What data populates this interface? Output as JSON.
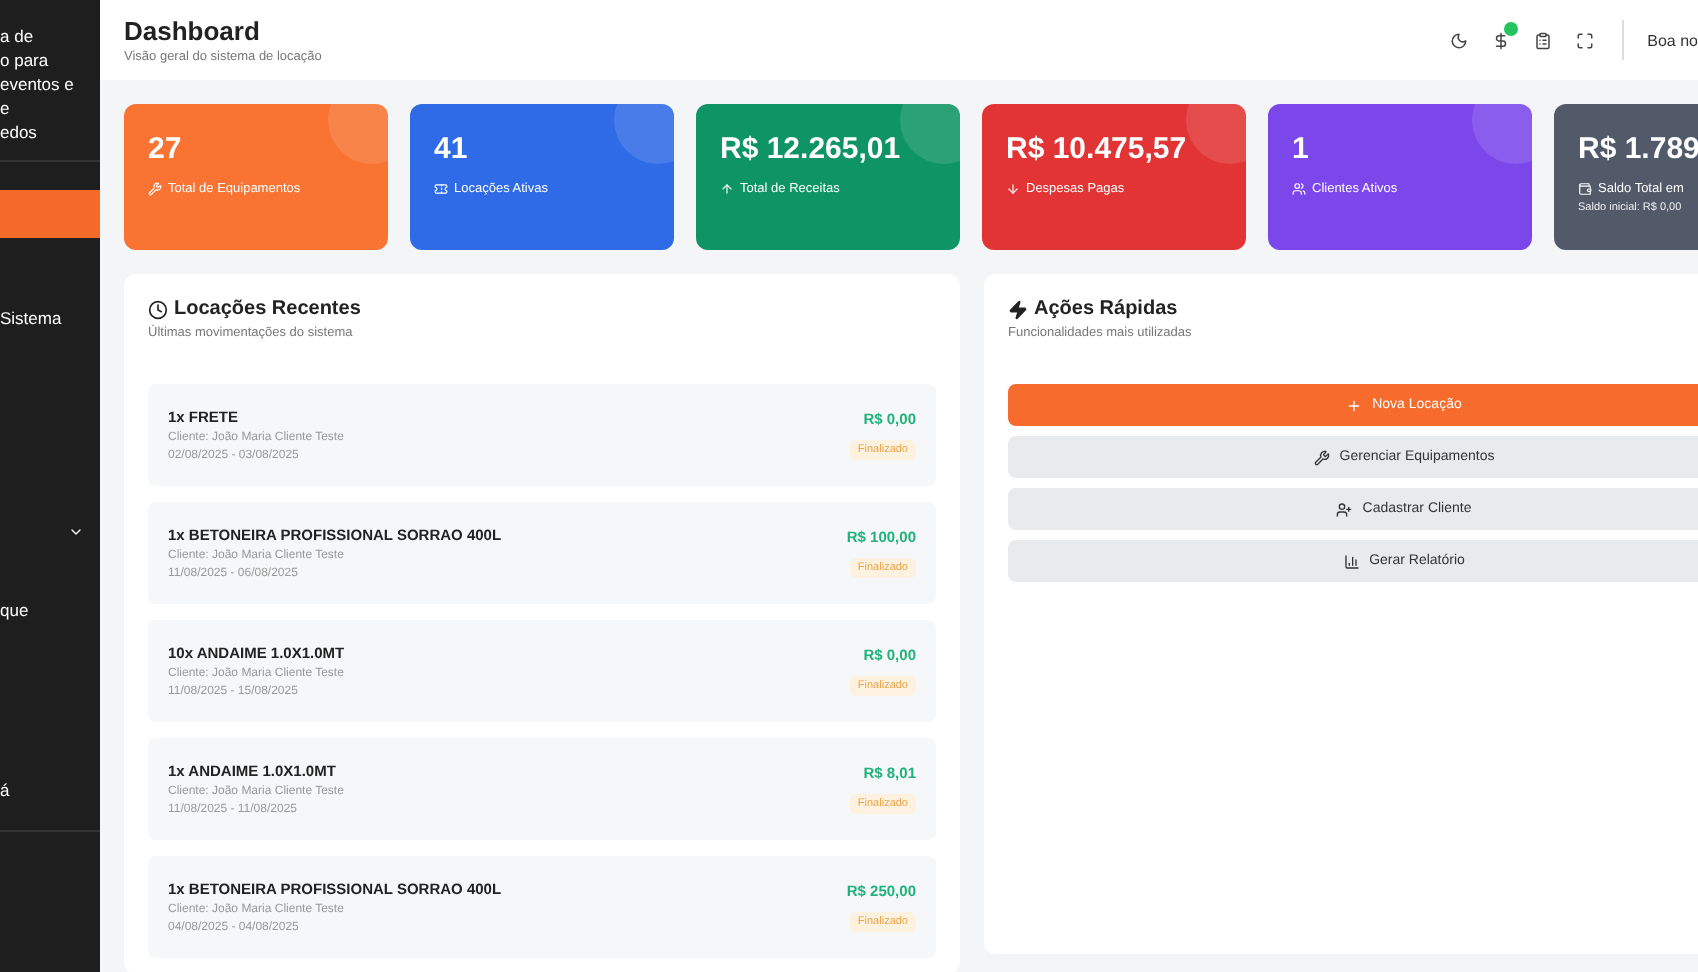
{
  "sidebar": {
    "brand_lines": [
      "a de",
      "o para",
      "eventos e",
      "e",
      "edos"
    ],
    "items": [
      {
        "selected": true
      },
      {
        "label": "Sistema",
        "selected": false
      },
      {
        "selected": false,
        "expanded": false
      },
      {
        "label": "que",
        "selected": false
      },
      {
        "label": "á",
        "selected": false
      }
    ]
  },
  "header": {
    "title": "Dashboard",
    "subtitle": "Visão geral do sistema de locação",
    "greeting": "Boa no"
  },
  "stats": [
    {
      "value": "27",
      "label": "Total de Equipamentos",
      "color": "#f97332"
    },
    {
      "value": "41",
      "label": "Locações Ativas",
      "color": "#2f6be6"
    },
    {
      "value": "R$ 12.265,01",
      "label": "Total de Receitas",
      "color": "#0e9465"
    },
    {
      "value": "R$ 10.475,57",
      "label": "Despesas Pagas",
      "color": "#e23434"
    },
    {
      "value": "1",
      "label": "Clientes Ativos",
      "color": "#7c47ea"
    },
    {
      "value": "R$ 1.789",
      "label": "Saldo Total em",
      "note": "Saldo inicial: R$ 0,00",
      "color": "#525a6a"
    }
  ],
  "recent": {
    "title": "Locações Recentes",
    "subtitle": "Últimas movimentações do sistema",
    "rows": [
      {
        "item": "1x FRETE",
        "client": "Cliente: João Maria Cliente Teste",
        "dates": "02/08/2025 - 03/08/2025",
        "amount": "R$ 0,00",
        "status": "Finalizado"
      },
      {
        "item": "1x BETONEIRA PROFISSIONAL SORRAO 400L",
        "client": "Cliente: João Maria Cliente Teste",
        "dates": "11/08/2025 - 06/08/2025",
        "amount": "R$ 100,00",
        "status": "Finalizado"
      },
      {
        "item": "10x ANDAIME 1.0X1.0MT",
        "client": "Cliente: João Maria Cliente Teste",
        "dates": "11/08/2025 - 15/08/2025",
        "amount": "R$ 0,00",
        "status": "Finalizado"
      },
      {
        "item": "1x ANDAIME 1.0X1.0MT",
        "client": "Cliente: João Maria Cliente Teste",
        "dates": "11/08/2025 - 11/08/2025",
        "amount": "R$ 8,01",
        "status": "Finalizado"
      },
      {
        "item": "1x BETONEIRA PROFISSIONAL SORRAO 400L",
        "client": "Cliente: João Maria Cliente Teste",
        "dates": "04/08/2025 - 04/08/2025",
        "amount": "R$ 250,00",
        "status": "Finalizado"
      }
    ]
  },
  "actions": {
    "title": "Ações Rápidas",
    "subtitle": "Funcionalidades mais utilizadas",
    "buttons": [
      {
        "label": "Nova Locação",
        "kind": "primary"
      },
      {
        "label": "Gerenciar Equipamentos",
        "kind": "secondary"
      },
      {
        "label": "Cadastrar Cliente",
        "kind": "secondary"
      },
      {
        "label": "Gerar Relatório",
        "kind": "secondary"
      }
    ]
  }
}
